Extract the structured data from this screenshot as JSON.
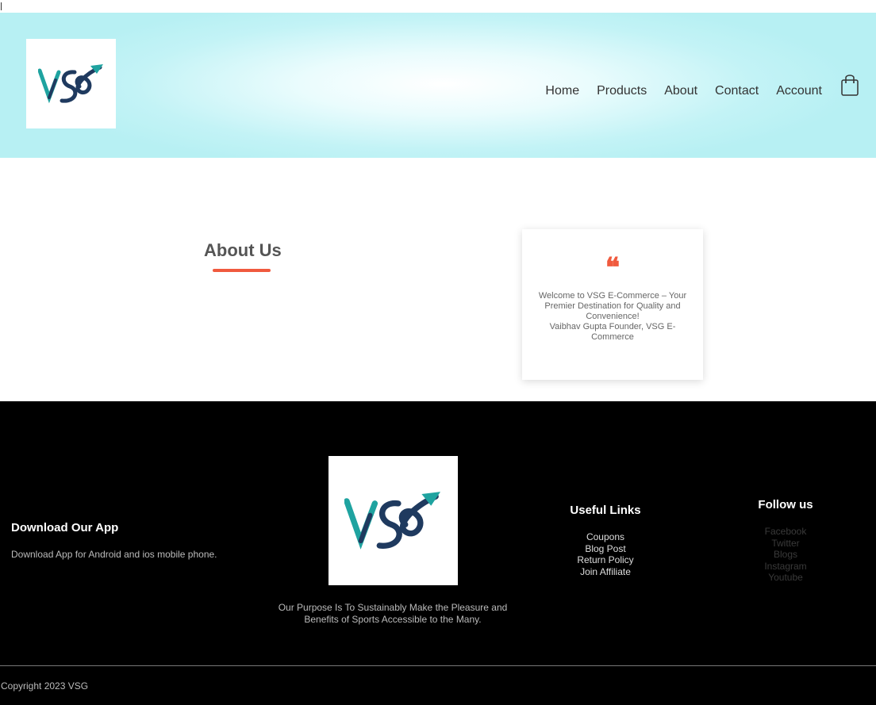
{
  "header": {
    "logo_name": "vsg-logo",
    "nav": [
      "Home",
      "Products",
      "About",
      "Contact",
      "Account"
    ],
    "cart_icon": "shopping-bag-icon"
  },
  "about": {
    "title": "About Us",
    "quote_mark": "66",
    "quote_line1": "Welcome to VSG E-Commerce – Your Premier Destination for Quality and Convenience!",
    "quote_line2": "Vaibhav Gupta Founder, VSG E-Commerce"
  },
  "footer": {
    "download_title": "Download Our App",
    "download_text": "Download App for Android and ios mobile phone.",
    "purpose": "Our Purpose Is To Sustainably Make the Pleasure and Benefits of Sports Accessible to the Many.",
    "useful_links_title": "Useful Links",
    "useful_links": [
      "Coupons",
      "Blog Post",
      "Return Policy",
      "Join Affiliate"
    ],
    "follow_title": "Follow us",
    "follow_links": [
      "Facebook",
      "Twitter",
      "Blogs",
      "Instagram",
      "Youtube"
    ],
    "copyright": "Copyright 2023 VSG"
  },
  "colors": {
    "accent": "#f05a3e",
    "header_bg": "#b7f0f3",
    "footer_bg": "#000000",
    "logo_teal": "#1fa3a0",
    "logo_navy": "#1f3a5f"
  }
}
